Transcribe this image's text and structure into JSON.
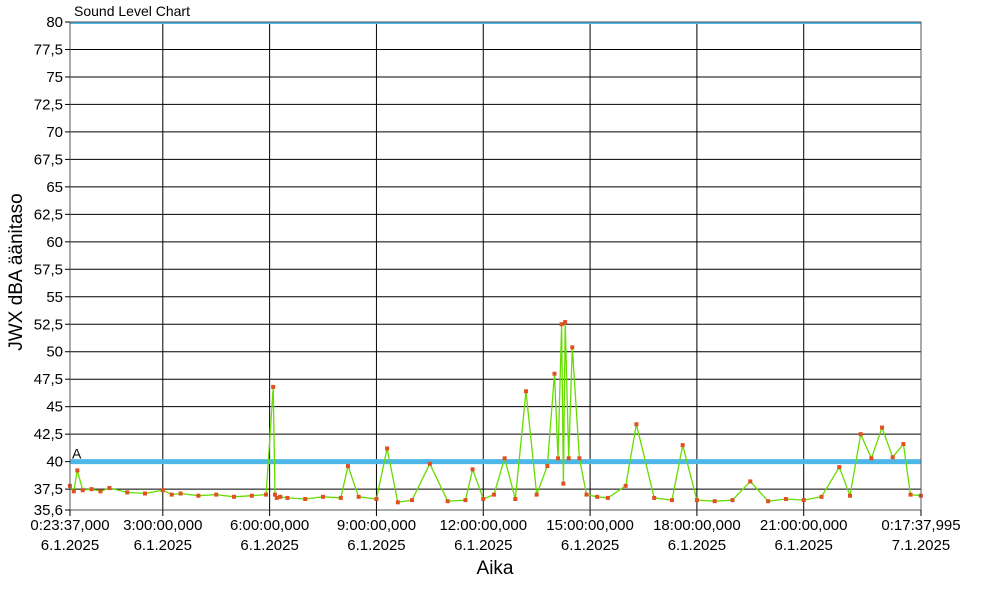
{
  "chart_data": {
    "type": "line",
    "title": "Sound Level Chart",
    "xlabel": "Aika",
    "ylabel": "JWX dBA äänitaso",
    "ylim": [
      35.6,
      80
    ],
    "y_ticks": [
      "35,6",
      "37,5",
      "40",
      "42,5",
      "45",
      "47,5",
      "50",
      "52,5",
      "55",
      "57,5",
      "60",
      "62,5",
      "65",
      "67,5",
      "70",
      "72,5",
      "75",
      "77,5",
      "80"
    ],
    "x_range_hours": [
      0.3936,
      24.294
    ],
    "x_ticks": [
      {
        "time": "0:23:37,000",
        "date": "6.1.2025"
      },
      {
        "time": "3:00:00,000",
        "date": "6.1.2025"
      },
      {
        "time": "6:00:00,000",
        "date": "6.1.2025"
      },
      {
        "time": "9:00:00,000",
        "date": "6.1.2025"
      },
      {
        "time": "12:00:00,000",
        "date": "6.1.2025"
      },
      {
        "time": "15:00:00,000",
        "date": "6.1.2025"
      },
      {
        "time": "18:00:00,000",
        "date": "6.1.2025"
      },
      {
        "time": "21:00:00,000",
        "date": "6.1.2025"
      },
      {
        "time": "0:17:37,995",
        "date": "7.1.2025"
      }
    ],
    "reference_line": {
      "label": "A",
      "value": 40,
      "color": "#4db8e8"
    },
    "series": [
      {
        "color": "#66dd00",
        "marker_color": "#e05020",
        "x_hours": [
          0.39,
          0.5,
          0.6,
          0.75,
          1,
          1.25,
          1.5,
          2,
          2.5,
          3,
          3.25,
          3.5,
          4,
          4.5,
          5,
          5.5,
          5.9,
          6.1,
          6.15,
          6.2,
          6.3,
          6.5,
          7,
          7.5,
          8,
          8.2,
          8.5,
          9,
          9.3,
          9.6,
          10,
          10.5,
          11,
          11.5,
          11.7,
          12,
          12.3,
          12.6,
          12.9,
          13.2,
          13.5,
          13.8,
          14,
          14.1,
          14.2,
          14.25,
          14.3,
          14.4,
          14.5,
          14.7,
          14.9,
          15.2,
          15.5,
          16,
          16.3,
          16.8,
          17.3,
          17.6,
          18,
          18.5,
          19,
          19.5,
          20,
          20.5,
          21,
          21.5,
          22,
          22.3,
          22.6,
          22.9,
          23.2,
          23.5,
          23.8,
          24,
          24.29
        ],
        "y_values": [
          37.8,
          37.3,
          39.2,
          37.4,
          37.5,
          37.3,
          37.6,
          37.2,
          37.1,
          37.4,
          37.0,
          37.1,
          36.9,
          37.0,
          36.8,
          36.9,
          37.0,
          46.8,
          37.0,
          36.7,
          36.8,
          36.7,
          36.6,
          36.8,
          36.7,
          39.6,
          36.8,
          36.6,
          41.2,
          36.3,
          36.5,
          39.8,
          36.4,
          36.5,
          39.3,
          36.6,
          37.0,
          40.3,
          36.6,
          46.4,
          37.0,
          39.6,
          48.0,
          40.3,
          52.5,
          38.0,
          52.7,
          40.3,
          50.4,
          40.3,
          37.0,
          36.8,
          36.7,
          37.8,
          43.4,
          36.7,
          36.5,
          41.5,
          36.5,
          36.4,
          36.5,
          38.2,
          36.4,
          36.6,
          36.5,
          36.8,
          39.5,
          36.9,
          42.5,
          40.3,
          43.1,
          40.4,
          41.6,
          37.0,
          36.9
        ]
      }
    ]
  }
}
